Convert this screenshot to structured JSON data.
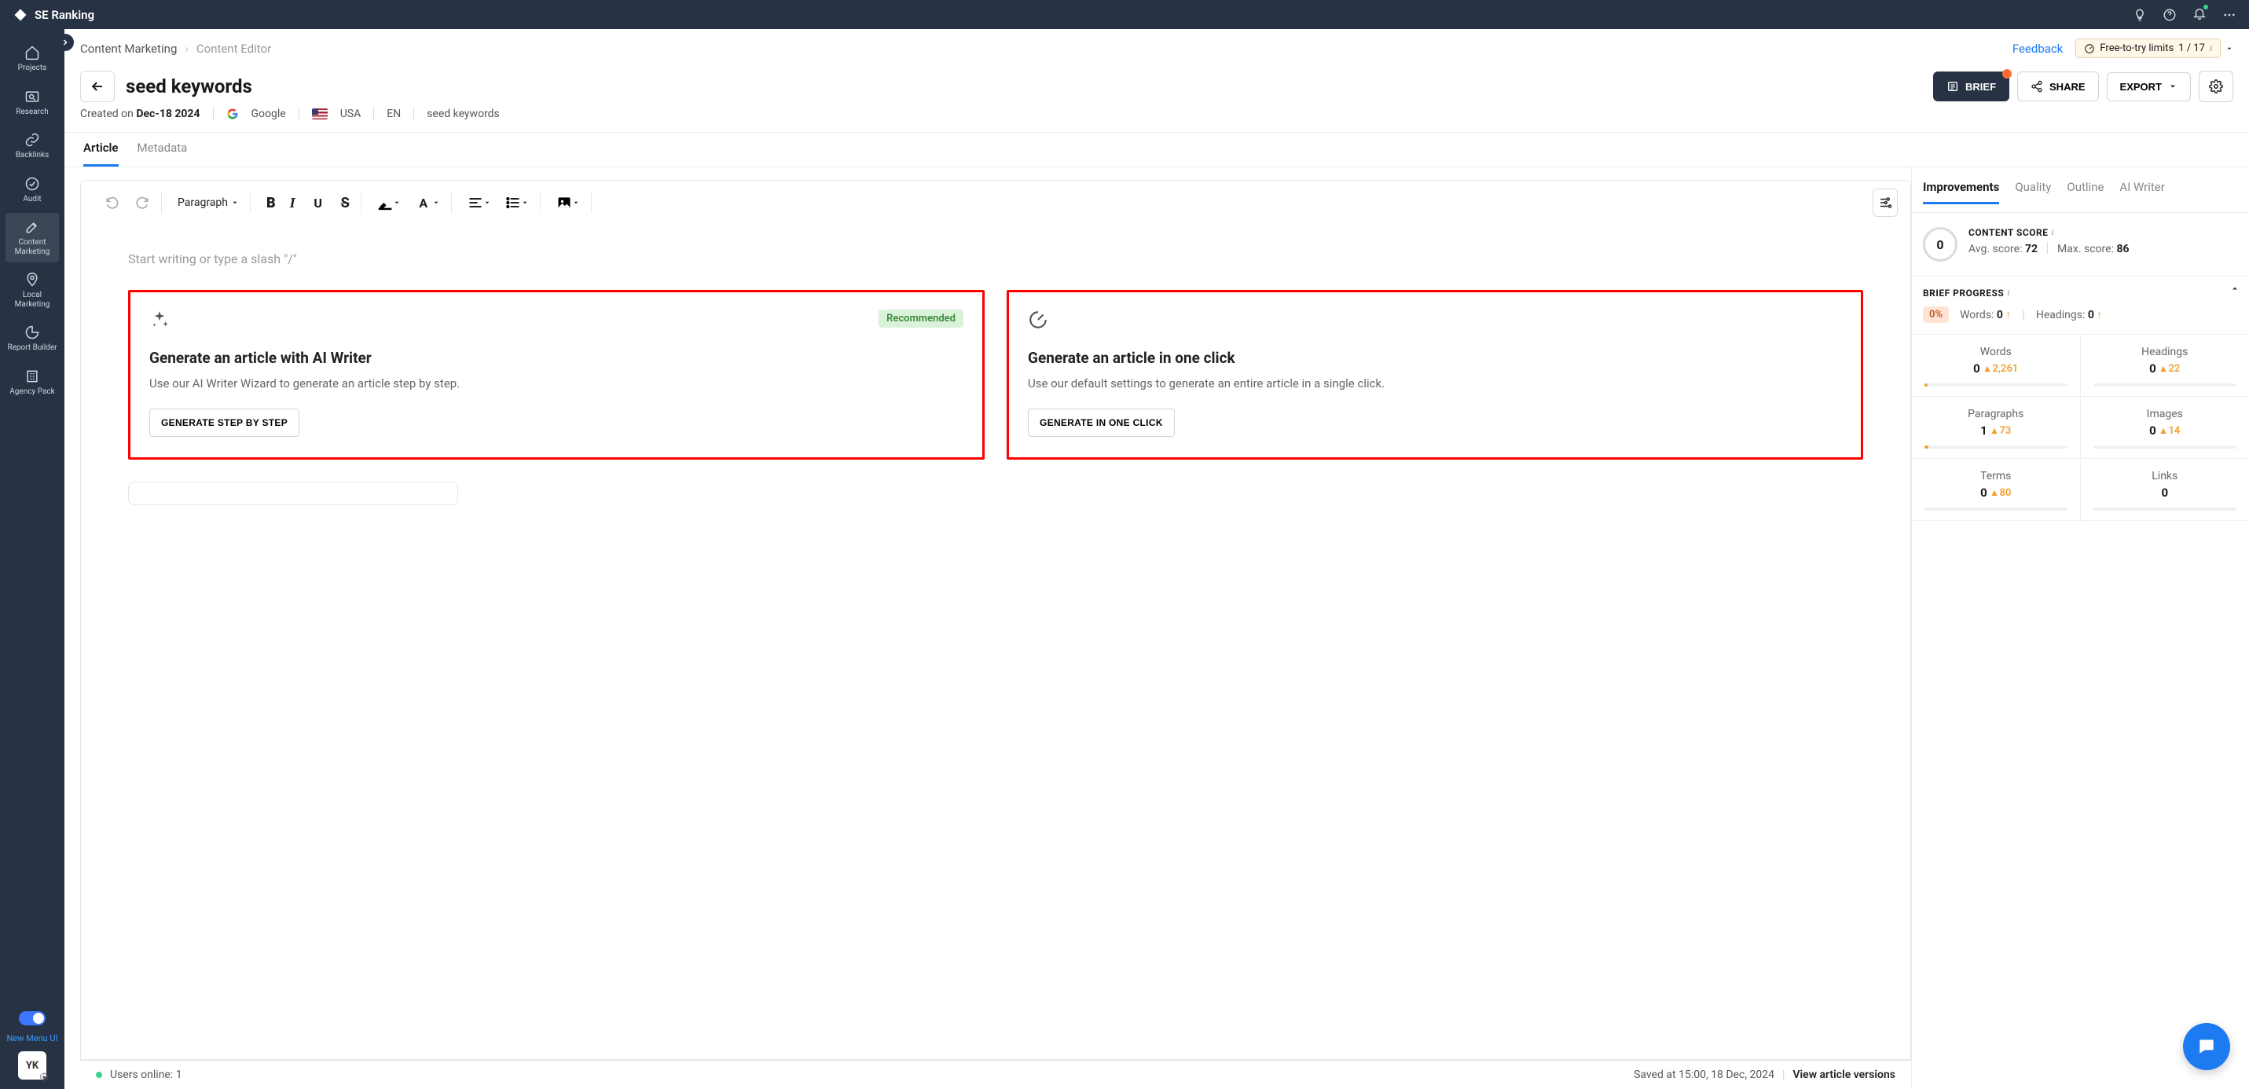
{
  "brand": "SE Ranking",
  "sidebar": {
    "items": [
      {
        "label": "Projects"
      },
      {
        "label": "Research"
      },
      {
        "label": "Backlinks"
      },
      {
        "label": "Audit"
      },
      {
        "label": "Content Marketing"
      },
      {
        "label": "Local Marketing"
      },
      {
        "label": "Report Builder"
      },
      {
        "label": "Agency Pack"
      }
    ],
    "new_menu": "New Menu UI",
    "avatar": "YK"
  },
  "breadcrumb": {
    "a": "Content Marketing",
    "b": "Content Editor",
    "feedback": "Feedback",
    "limits_label": "Free-to-try limits",
    "limits_count": "1 / 17"
  },
  "title": {
    "back": "←",
    "text": "seed keywords",
    "brief": "BRIEF",
    "share": "SHARE",
    "export": "EXPORT"
  },
  "meta": {
    "created_label": "Created on",
    "created_date": "Dec-18 2024",
    "search_engine": "Google",
    "country": "USA",
    "lang": "EN",
    "keyword": "seed keywords"
  },
  "tabs": {
    "article": "Article",
    "metadata": "Metadata"
  },
  "toolbar": {
    "paragraph": "Paragraph"
  },
  "editor": {
    "placeholder": "Start writing or type a slash \"/\"",
    "card1": {
      "recommended": "Recommended",
      "title": "Generate an article with AI Writer",
      "desc": "Use our AI Writer Wizard to generate an article step by step.",
      "btn": "GENERATE STEP BY STEP"
    },
    "card2": {
      "title": "Generate an article in one click",
      "desc": "Use our default settings to generate an entire article in a single click.",
      "btn": "GENERATE IN ONE CLICK"
    }
  },
  "footer": {
    "users_label": "Users online:",
    "users_count": "1",
    "saved": "Saved at 15:00, 18 Dec, 2024",
    "versions": "View article versions"
  },
  "right": {
    "tabs": {
      "improvements": "Improvements",
      "quality": "Quality",
      "outline": "Outline",
      "aiwriter": "AI Writer"
    },
    "score": {
      "title": "CONTENT SCORE",
      "value": "0",
      "avg_label": "Avg. score:",
      "avg": "72",
      "max_label": "Max. score:",
      "max": "86"
    },
    "brief": {
      "title": "BRIEF PROGRESS",
      "pct": "0%",
      "words_label": "Words:",
      "words": "0",
      "headings_label": "Headings:",
      "headings": "0"
    },
    "metrics": [
      {
        "label": "Words",
        "cur": "0",
        "tgt": "2,261"
      },
      {
        "label": "Headings",
        "cur": "0",
        "tgt": "22"
      },
      {
        "label": "Paragraphs",
        "cur": "1",
        "tgt": "73"
      },
      {
        "label": "Images",
        "cur": "0",
        "tgt": "14"
      },
      {
        "label": "Terms",
        "cur": "0",
        "tgt": "80"
      },
      {
        "label": "Links",
        "cur": "0",
        "tgt": ""
      }
    ]
  }
}
